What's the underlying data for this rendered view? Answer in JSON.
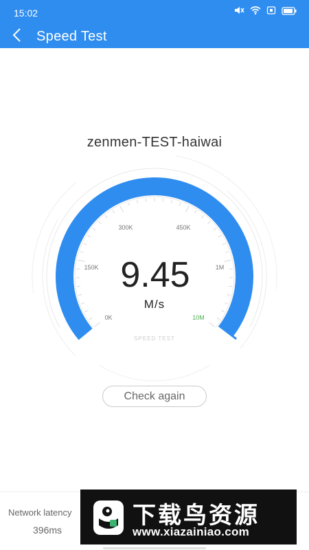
{
  "status_bar": {
    "time": "15:02",
    "icons": [
      "mute-icon",
      "wifi-icon",
      "sim-icon",
      "battery-icon"
    ]
  },
  "header": {
    "title": "Speed Test",
    "back_icon": "chevron-left-icon"
  },
  "network": {
    "name": "zenmen-TEST-haiwai"
  },
  "gauge": {
    "value": "9.45",
    "unit": "M/s",
    "caption": "SPEED TEST",
    "tick_labels": [
      "0K",
      "150K",
      "300K",
      "450K",
      "1M",
      "10M"
    ],
    "active_tick": "10M",
    "progress_fraction": 0.99
  },
  "actions": {
    "check_again_label": "Check again"
  },
  "stats": {
    "latency_label": "Network latency",
    "latency_value": "396ms"
  },
  "watermark": {
    "title": "下载鸟资源",
    "url": "www.xiazainiao.com"
  },
  "colors": {
    "primary": "#2f8df0",
    "gauge_blue": "#2f8df0",
    "active_tick": "#4caf50"
  }
}
